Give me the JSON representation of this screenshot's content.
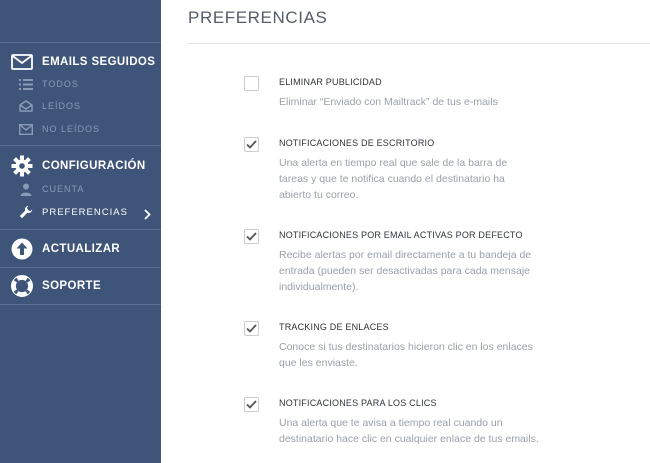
{
  "sidebar": {
    "emails": {
      "label": "EMAILS SEGUIDOS",
      "icon": "envelope-icon",
      "items": [
        {
          "label": "TODOS",
          "icon": "list-icon"
        },
        {
          "label": "LEÍDOS",
          "icon": "envelope-open-icon"
        },
        {
          "label": "NO LEÍDOS",
          "icon": "envelope-icon"
        }
      ]
    },
    "config": {
      "label": "CONFIGURACIÓN",
      "icon": "gear-icon",
      "items": [
        {
          "label": "CUENTA",
          "icon": "user-icon"
        },
        {
          "label": "PREFERENCIAS",
          "icon": "wrench-icon",
          "active": true
        }
      ]
    },
    "update": {
      "label": "ACTUALIZAR",
      "icon": "arrow-up-circle-icon"
    },
    "support": {
      "label": "SOPORTE",
      "icon": "lifebuoy-icon"
    }
  },
  "main": {
    "title": "PREFERENCIAS",
    "preferences": [
      {
        "title": "ELIMINAR PUBLICIDAD",
        "description": "Eliminar “Enviado con Mailtrack” de tus e-mails",
        "checked": false
      },
      {
        "title": "NOTIFICACIONES DE ESCRITORIO",
        "description": "Una alerta en tiempo real que sale de la barra de tareas y que te notifica cuando el destinatario ha abierto tu correo.",
        "checked": true
      },
      {
        "title": "NOTIFICACIONES POR EMAIL ACTIVAS POR DEFECTO",
        "description": "Recibe alertas por email directamente a tu bandeja de entrada (pueden ser desactivadas para cada mensaje individualmente).",
        "checked": true
      },
      {
        "title": "TRACKING DE ENLACES",
        "description": "Conoce si tus destinatarios hicieron clic en los enlaces que les enviaste.",
        "checked": true
      },
      {
        "title": "NOTIFICACIONES PARA LOS CLICS",
        "description": "Una alerta que te avisa a tiempo real cuando un destinatario hace clic en cualquier enlace de tus emails.",
        "checked": true
      }
    ]
  },
  "colors": {
    "sidebar_bg": "#3e5478",
    "sidebar_sub_text": "#8a9bb8",
    "check_color": "#555555"
  }
}
